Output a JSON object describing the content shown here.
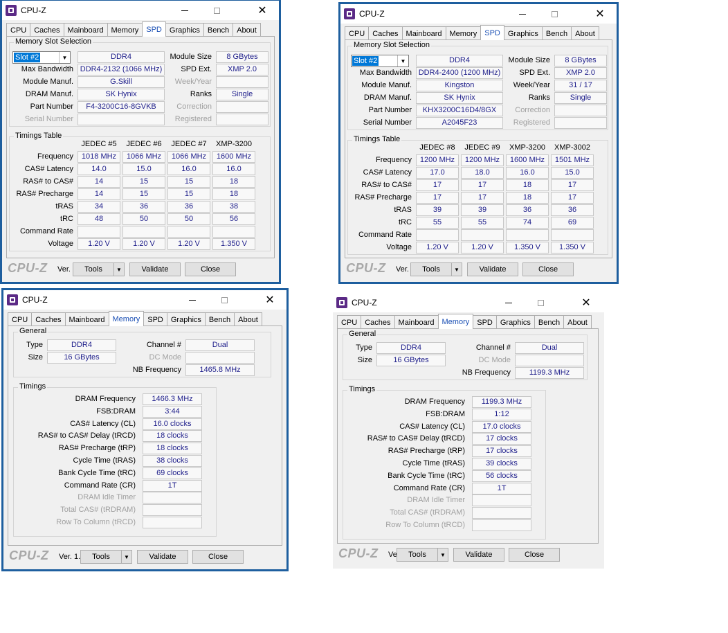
{
  "app": {
    "title": "CPU-Z",
    "tabs": [
      "CPU",
      "Caches",
      "Mainboard",
      "Memory",
      "SPD",
      "Graphics",
      "Bench",
      "About"
    ],
    "brand": "CPU-Z",
    "version": "Ver. 1.91.0.x64",
    "tools_label": "Tools",
    "validate_label": "Validate",
    "close_label": "Close"
  },
  "spd_labels": {
    "slot_group": "Memory Slot Selection",
    "max_bandwidth": "Max Bandwidth",
    "module_manuf": "Module Manuf.",
    "dram_manuf": "DRAM Manuf.",
    "part_number": "Part Number",
    "serial_number": "Serial Number",
    "module_size": "Module Size",
    "spd_ext": "SPD Ext.",
    "week_year": "Week/Year",
    "ranks": "Ranks",
    "correction": "Correction",
    "registered": "Registered",
    "timings_group": "Timings Table",
    "rows": [
      "Frequency",
      "CAS# Latency",
      "RAS# to CAS#",
      "RAS# Precharge",
      "tRAS",
      "tRC",
      "Command Rate",
      "Voltage"
    ]
  },
  "mem_labels": {
    "general_group": "General",
    "type": "Type",
    "size": "Size",
    "channel": "Channel #",
    "dc_mode": "DC Mode",
    "nb_freq": "NB Frequency",
    "timings_group": "Timings",
    "rows": [
      "DRAM Frequency",
      "FSB:DRAM",
      "CAS# Latency (CL)",
      "RAS# to CAS# Delay (tRCD)",
      "RAS# Precharge (tRP)",
      "Cycle Time (tRAS)",
      "Bank Cycle Time (tRC)",
      "Command Rate (CR)",
      "DRAM Idle Timer",
      "Total CAS# (tRDRAM)",
      "Row To Column (tRCD)"
    ]
  },
  "spd1": {
    "slot": "Slot #2",
    "type": "DDR4",
    "max_bandwidth": "DDR4-2132 (1066 MHz)",
    "module_manuf": "G.Skill",
    "dram_manuf": "SK Hynix",
    "part_number": "F4-3200C16-8GVKB",
    "serial_number": "",
    "module_size": "8 GBytes",
    "spd_ext": "XMP 2.0",
    "week_year": "",
    "ranks": "Single",
    "cols": [
      "JEDEC #5",
      "JEDEC #6",
      "JEDEC #7",
      "XMP-3200"
    ],
    "cells": [
      [
        "1018 MHz",
        "1066 MHz",
        "1066 MHz",
        "1600 MHz"
      ],
      [
        "14.0",
        "15.0",
        "16.0",
        "16.0"
      ],
      [
        "14",
        "15",
        "15",
        "18"
      ],
      [
        "14",
        "15",
        "15",
        "18"
      ],
      [
        "34",
        "36",
        "36",
        "38"
      ],
      [
        "48",
        "50",
        "50",
        "56"
      ],
      [
        "",
        "",
        "",
        ""
      ],
      [
        "1.20 V",
        "1.20 V",
        "1.20 V",
        "1.350 V"
      ]
    ]
  },
  "spd2": {
    "slot": "Slot #2",
    "type": "DDR4",
    "max_bandwidth": "DDR4-2400 (1200 MHz)",
    "module_manuf": "Kingston",
    "dram_manuf": "SK Hynix",
    "part_number": "KHX3200C16D4/8GX",
    "serial_number": "A2045F23",
    "module_size": "8 GBytes",
    "spd_ext": "XMP 2.0",
    "week_year": "31 / 17",
    "ranks": "Single",
    "cols": [
      "JEDEC #8",
      "JEDEC #9",
      "XMP-3200",
      "XMP-3002"
    ],
    "cells": [
      [
        "1200 MHz",
        "1200 MHz",
        "1600 MHz",
        "1501 MHz"
      ],
      [
        "17.0",
        "18.0",
        "16.0",
        "15.0"
      ],
      [
        "17",
        "17",
        "18",
        "17"
      ],
      [
        "17",
        "17",
        "18",
        "17"
      ],
      [
        "39",
        "39",
        "36",
        "36"
      ],
      [
        "55",
        "55",
        "74",
        "69"
      ],
      [
        "",
        "",
        "",
        ""
      ],
      [
        "1.20 V",
        "1.20 V",
        "1.350 V",
        "1.350 V"
      ]
    ]
  },
  "mem1": {
    "type": "DDR4",
    "size": "16 GBytes",
    "channel": "Dual",
    "dc_mode": "",
    "nb_freq": "1465.8 MHz",
    "values": [
      "1466.3 MHz",
      "3:44",
      "16.0 clocks",
      "18 clocks",
      "18 clocks",
      "38 clocks",
      "69 clocks",
      "1T",
      "",
      "",
      ""
    ]
  },
  "mem2": {
    "type": "DDR4",
    "size": "16 GBytes",
    "channel": "Dual",
    "dc_mode": "",
    "nb_freq": "1199.3 MHz",
    "values": [
      "1199.3 MHz",
      "1:12",
      "17.0 clocks",
      "17 clocks",
      "17 clocks",
      "39 clocks",
      "56 clocks",
      "1T",
      "",
      "",
      ""
    ]
  },
  "colors": {
    "accent": "#1a4fb4",
    "value_text": "#1d1d8a",
    "frame": "#1e5f9f",
    "icon": "#5b2a86"
  }
}
